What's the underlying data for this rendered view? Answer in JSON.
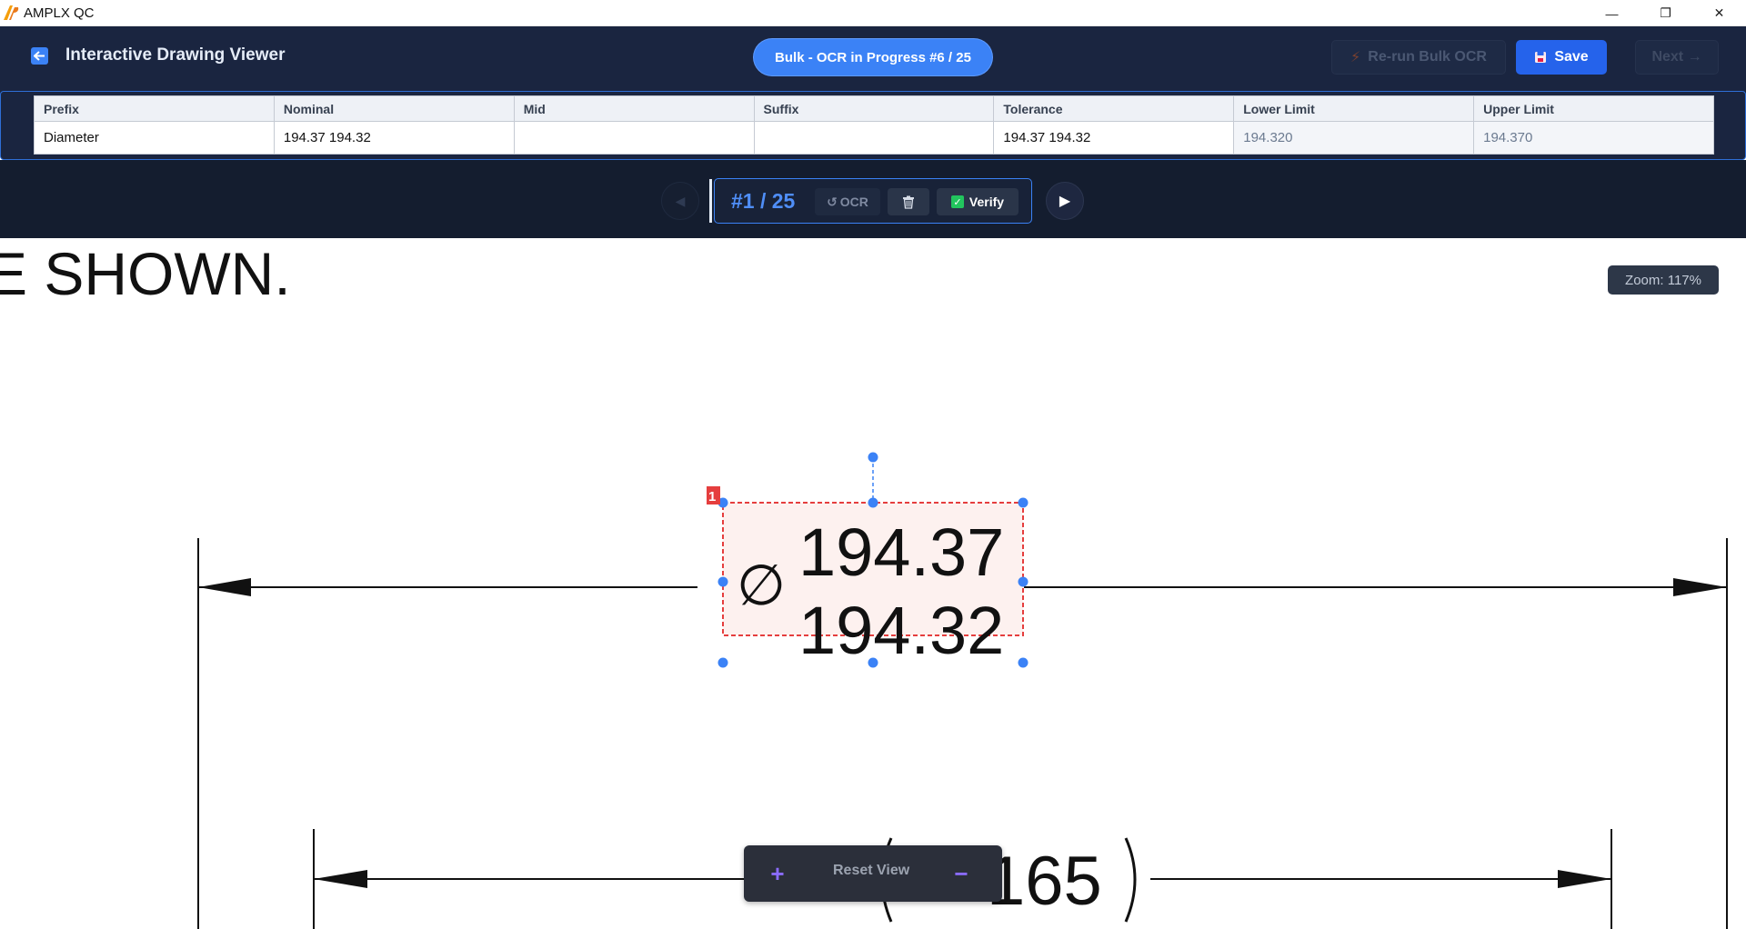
{
  "window": {
    "title": "AMPLX QC",
    "minimize_glyph": "—",
    "restore_glyph": "❐",
    "close_glyph": "✕"
  },
  "header": {
    "title": "Interactive Drawing Viewer",
    "bulk_status": "Bulk - OCR in Progress #6 / 25",
    "rerun_label": "Re-run Bulk OCR",
    "save_label": "Save",
    "next_label": "Next →"
  },
  "fields_table": {
    "columns": [
      "Prefix",
      "Nominal",
      "Mid",
      "Suffix",
      "Tolerance",
      "Lower Limit",
      "Upper Limit"
    ],
    "row": {
      "prefix": "Diameter",
      "nominal": "194.37 194.32",
      "mid": "",
      "suffix": "",
      "tolerance": "194.37 194.32",
      "lower_limit": "194.320",
      "upper_limit": "194.370"
    }
  },
  "navigator": {
    "counter": "#1 / 25",
    "ocr_label": "OCR",
    "verify_label": "Verify",
    "prev_glyph": "◀",
    "next_glyph": "▶"
  },
  "canvas": {
    "zoom_label": "Zoom: 117%",
    "reset_label": "Reset View",
    "zoom_in_glyph": "+",
    "zoom_out_glyph": "−",
    "drawing_note": "E SHOWN.",
    "dimension_upper": "194.37",
    "dimension_lower": "194.32",
    "diameter_symbol": "∅",
    "secondary_dimension": "165",
    "annotation_index": "1"
  },
  "colors": {
    "accent": "#3b82f6",
    "header_bg": "#1a2540",
    "nav_bg": "#141d2f",
    "selection_red": "#e53e3e",
    "handle_blue": "#3b82f6"
  }
}
